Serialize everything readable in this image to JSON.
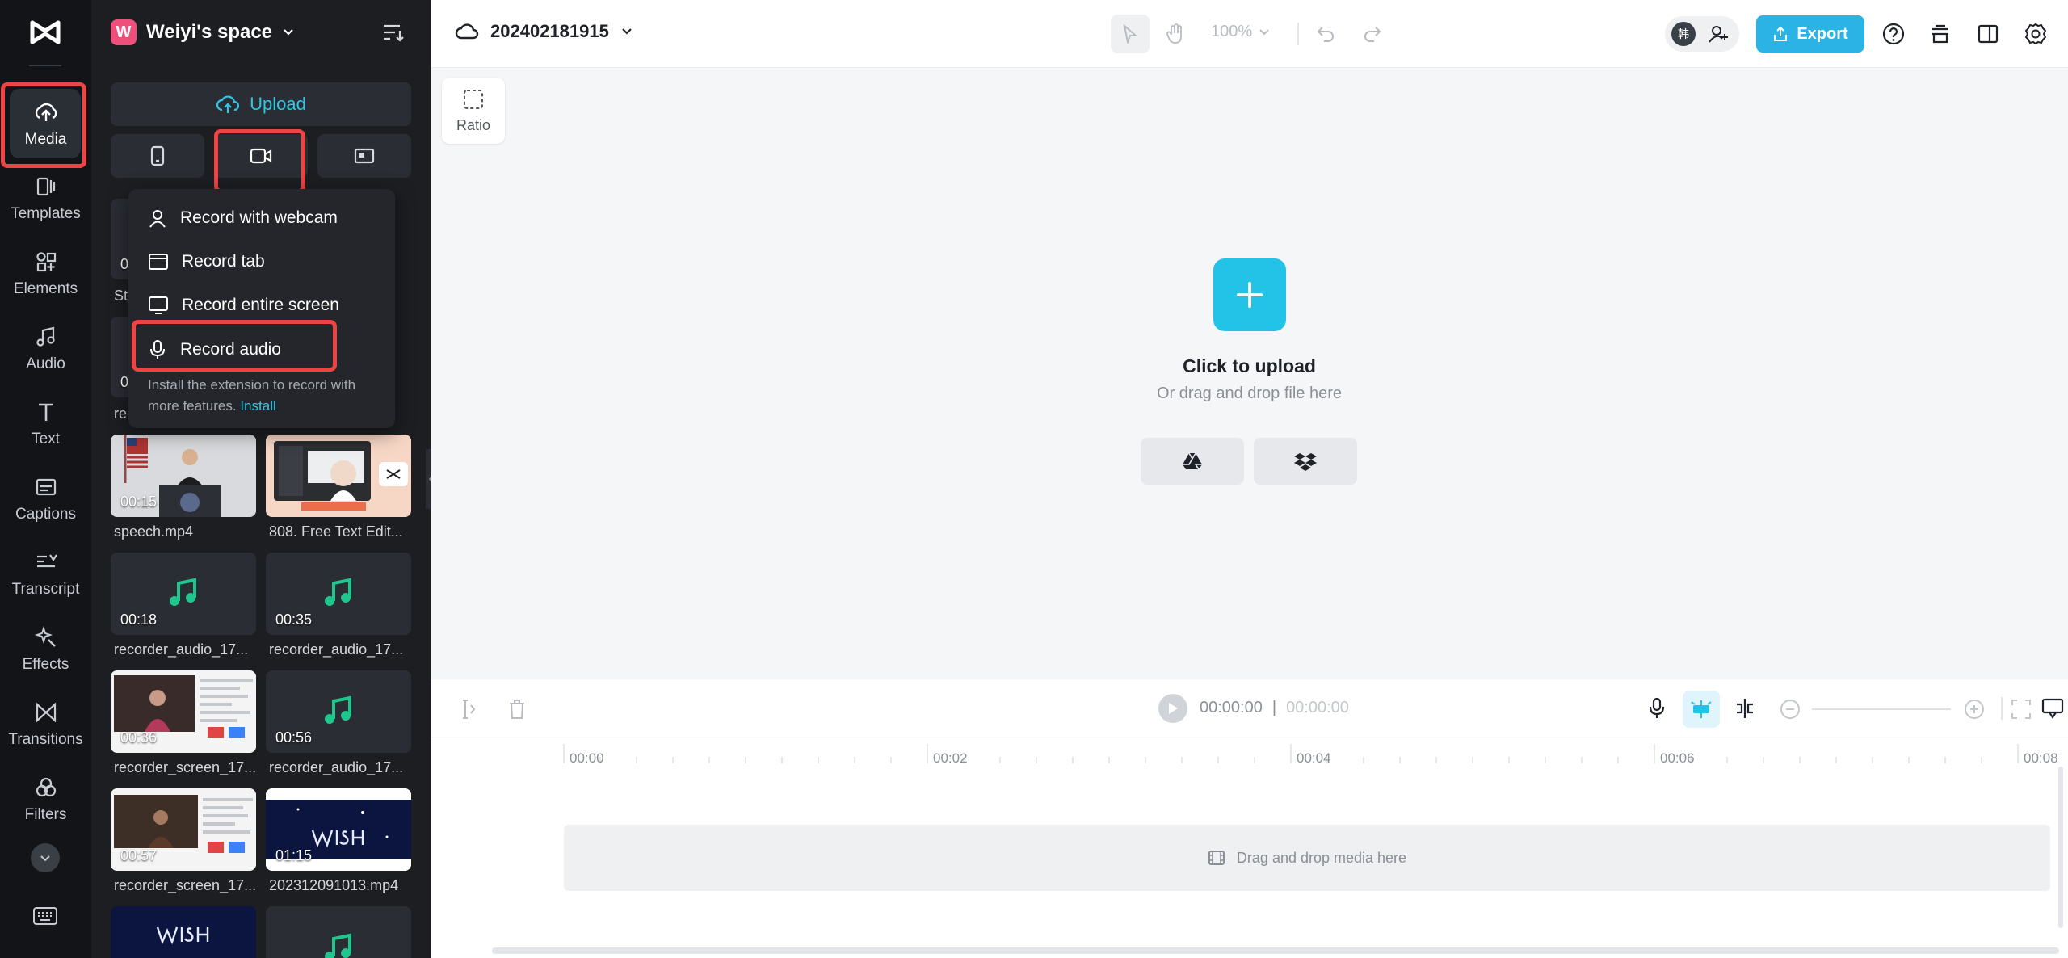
{
  "rail": {
    "items": [
      {
        "label": "Media",
        "icon": "cloud-upload-icon"
      },
      {
        "label": "Templates",
        "icon": "templates-icon"
      },
      {
        "label": "Elements",
        "icon": "elements-icon"
      },
      {
        "label": "Audio",
        "icon": "music-note-icon"
      },
      {
        "label": "Text",
        "icon": "text-icon"
      },
      {
        "label": "Captions",
        "icon": "captions-icon"
      },
      {
        "label": "Transcript",
        "icon": "transcript-icon"
      },
      {
        "label": "Effects",
        "icon": "effects-icon"
      },
      {
        "label": "Transitions",
        "icon": "transitions-icon"
      },
      {
        "label": "Filters",
        "icon": "filters-icon"
      }
    ]
  },
  "panel": {
    "space_badge": "W",
    "space_name": "Weiyi's space",
    "upload_label": "Upload",
    "media": [
      {
        "label": "speech.mp4",
        "duration": "00:15"
      },
      {
        "label": "808. Free Text Edit...",
        "duration": ""
      },
      {
        "label": "recorder_audio_17...",
        "duration": "00:18"
      },
      {
        "label": "recorder_audio_17...",
        "duration": "00:35"
      },
      {
        "label": "recorder_screen_17...",
        "duration": "00:36"
      },
      {
        "label": "recorder_audio_17...",
        "duration": "00:56"
      },
      {
        "label": "recorder_screen_17...",
        "duration": "00:57"
      },
      {
        "label": "202312091013.mp4",
        "duration": "01:15"
      }
    ],
    "hidden_labels": [
      "St",
      "re"
    ],
    "hidden_durations": [
      "0",
      "0"
    ]
  },
  "dropdown": {
    "items": [
      {
        "label": "Record with webcam",
        "icon": "person-icon"
      },
      {
        "label": "Record tab",
        "icon": "browser-tab-icon"
      },
      {
        "label": "Record entire screen",
        "icon": "monitor-icon"
      },
      {
        "label": "Record audio",
        "icon": "microphone-icon"
      }
    ],
    "note": "Install the extension to record with more features.",
    "install_link": "Install"
  },
  "topbar": {
    "project_name": "202402181915",
    "zoom": "100%",
    "export_label": "Export",
    "avatar_text": "韩"
  },
  "canvas": {
    "ratio_label": "Ratio",
    "upload_title": "Click to upload",
    "upload_sub": "Or drag and drop file here"
  },
  "timeline": {
    "current_time": "00:00:00",
    "separator": "|",
    "total_time": "00:00:00",
    "ticks": [
      "00:00",
      "00:02",
      "00:04",
      "00:06",
      "00:08"
    ],
    "dropzone_text": "Drag and drop media here"
  },
  "colors": {
    "accent": "#22c3e6",
    "highlight": "#ef4444",
    "rail_bg": "#121417",
    "panel_bg": "#1c1e22"
  }
}
